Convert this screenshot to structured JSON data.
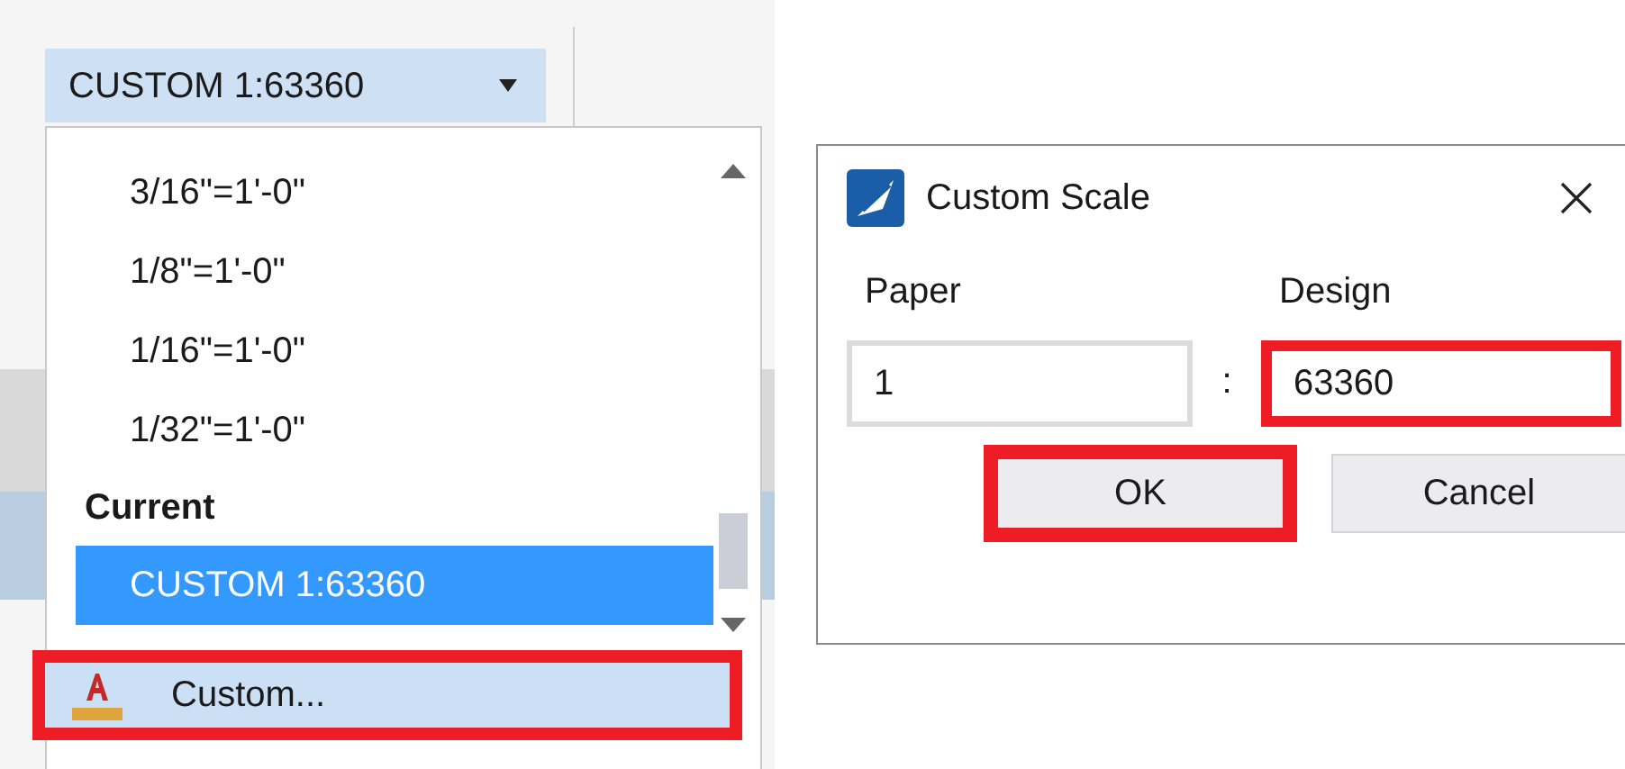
{
  "scale_combo": {
    "value": "CUSTOM 1:63360"
  },
  "dropdown": {
    "items": [
      {
        "kind": "option",
        "label": "3/16\"=1'-0\"",
        "selected": false
      },
      {
        "kind": "option",
        "label": "1/8\"=1'-0\"",
        "selected": false
      },
      {
        "kind": "option",
        "label": "1/16\"=1'-0\"",
        "selected": false
      },
      {
        "kind": "option",
        "label": "1/32\"=1'-0\"",
        "selected": false
      },
      {
        "kind": "header",
        "label": "Current"
      },
      {
        "kind": "option",
        "label": "CUSTOM 1:63360",
        "selected": true
      }
    ],
    "custom_action": {
      "label": "Custom...",
      "highlighted": true
    }
  },
  "dialog": {
    "title": "Custom Scale",
    "separator": ":",
    "fields": [
      {
        "label": "Paper",
        "value": "1",
        "highlighted": false
      },
      {
        "label": "Design",
        "value": "63360",
        "highlighted": true
      }
    ],
    "buttons": [
      {
        "label": "OK",
        "highlighted": true
      },
      {
        "label": "Cancel",
        "highlighted": false
      }
    ]
  }
}
